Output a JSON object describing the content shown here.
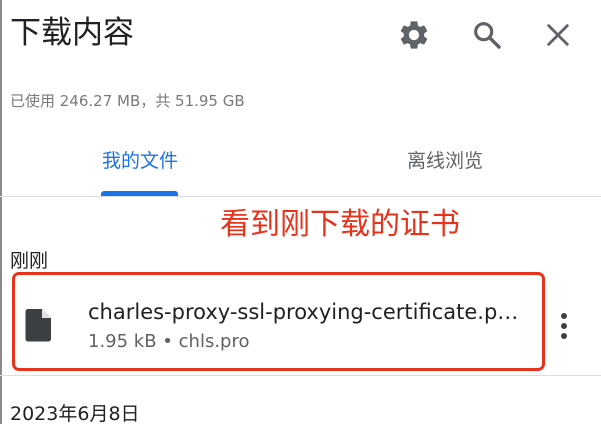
{
  "header": {
    "title": "下载内容",
    "settings_icon": "gear-icon",
    "search_icon": "search-icon",
    "close_icon": "close-icon"
  },
  "storage": {
    "text": "已使用 246.27 MB，共 51.95 GB"
  },
  "tabs": [
    {
      "label": "我的文件",
      "selected": true
    },
    {
      "label": "离线浏览",
      "selected": false
    }
  ],
  "annotation": {
    "text": "看到刚下载的证书",
    "color": "#e8331c"
  },
  "sections": [
    {
      "label": "刚刚",
      "items": [
        {
          "file_name": "charles-proxy-ssl-proxying-certificate.pem",
          "meta": "1.95 kB • chls.pro",
          "icon": "file-icon",
          "menu_icon": "more-vert-icon"
        }
      ]
    },
    {
      "label": "2023年6月8日",
      "items": []
    }
  ],
  "colors": {
    "accent": "#1a73e8",
    "text_primary": "#202124",
    "text_secondary": "#5f6368",
    "highlight": "#e8331c"
  }
}
